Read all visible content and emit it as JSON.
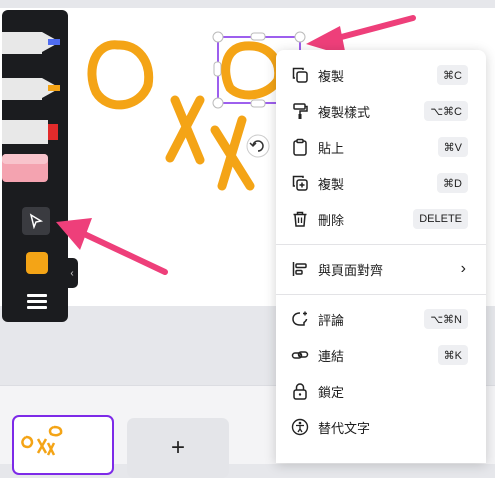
{
  "context_menu": {
    "items": [
      {
        "label": "複製",
        "shortcut": "⌘C",
        "icon": "copy-icon"
      },
      {
        "label": "複製樣式",
        "shortcut": "⌥⌘C",
        "icon": "paint-roller-icon"
      },
      {
        "label": "貼上",
        "shortcut": "⌘V",
        "icon": "clipboard-icon"
      },
      {
        "label": "複製",
        "shortcut": "⌘D",
        "icon": "duplicate-icon"
      },
      {
        "label": "刪除",
        "shortcut": "DELETE",
        "icon": "trash-icon"
      },
      {
        "label": "與頁面對齊",
        "shortcut": "",
        "icon": "align-icon"
      },
      {
        "label": "評論",
        "shortcut": "⌥⌘N",
        "icon": "comment-icon"
      },
      {
        "label": "連結",
        "shortcut": "⌘K",
        "icon": "link-icon"
      },
      {
        "label": "鎖定",
        "shortcut": "",
        "icon": "lock-icon"
      },
      {
        "label": "替代文字",
        "shortcut": "",
        "icon": "accessibility-icon"
      }
    ]
  },
  "add_page": {
    "label": "+"
  },
  "colors": {
    "accent": "#7d2ae8",
    "ink": "#f4a416",
    "arrow": "#ee3f7a",
    "toolbar": "#1b1c1f"
  }
}
